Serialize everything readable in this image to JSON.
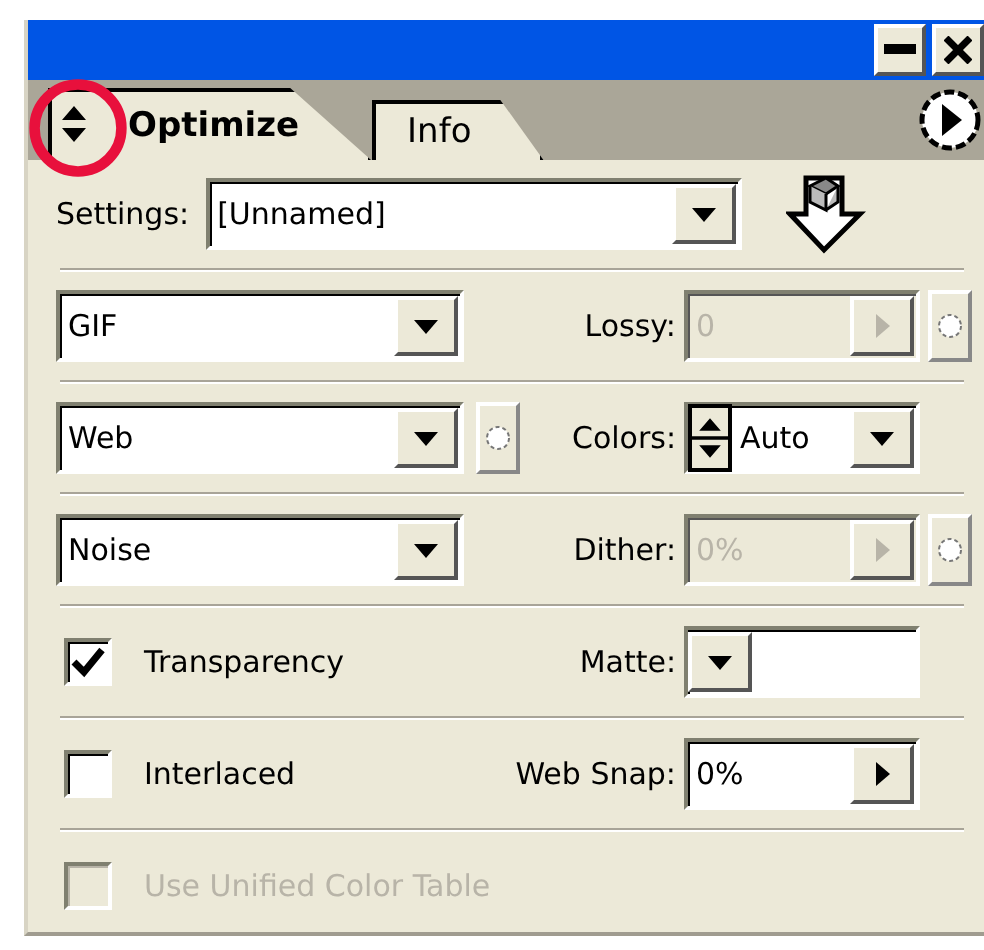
{
  "tabs": [
    {
      "label": "Optimize",
      "selected": true
    },
    {
      "label": "Info",
      "selected": false
    }
  ],
  "settings": {
    "label": "Settings:",
    "value": "[Unnamed]"
  },
  "rows": [
    {
      "left": {
        "kind": "dropdown",
        "value": "GIF"
      },
      "right": {
        "kind": "popup-field",
        "label": "Lossy:",
        "value": "0",
        "disabled": true,
        "link": true
      }
    },
    {
      "left": {
        "kind": "dropdown",
        "value": "Web",
        "link": true
      },
      "right": {
        "kind": "spinner-dropdown",
        "label": "Colors:",
        "value": "Auto"
      }
    },
    {
      "left": {
        "kind": "dropdown",
        "value": "Noise"
      },
      "right": {
        "kind": "popup-field",
        "label": "Dither:",
        "value": "0%",
        "disabled": true,
        "link": true
      }
    },
    {
      "left": {
        "kind": "checkbox",
        "label": "Transparency",
        "checked": true,
        "disabled": false
      },
      "right": {
        "kind": "dropdown",
        "label": "Matte:"
      }
    },
    {
      "left": {
        "kind": "checkbox",
        "label": "Interlaced",
        "checked": false,
        "disabled": false
      },
      "right": {
        "kind": "popup-field",
        "label": "Web Snap:",
        "value": "0%",
        "disabled": false
      }
    },
    {
      "left": {
        "kind": "checkbox",
        "label": "Use Unified Color Table",
        "checked": false,
        "disabled": true
      }
    }
  ]
}
